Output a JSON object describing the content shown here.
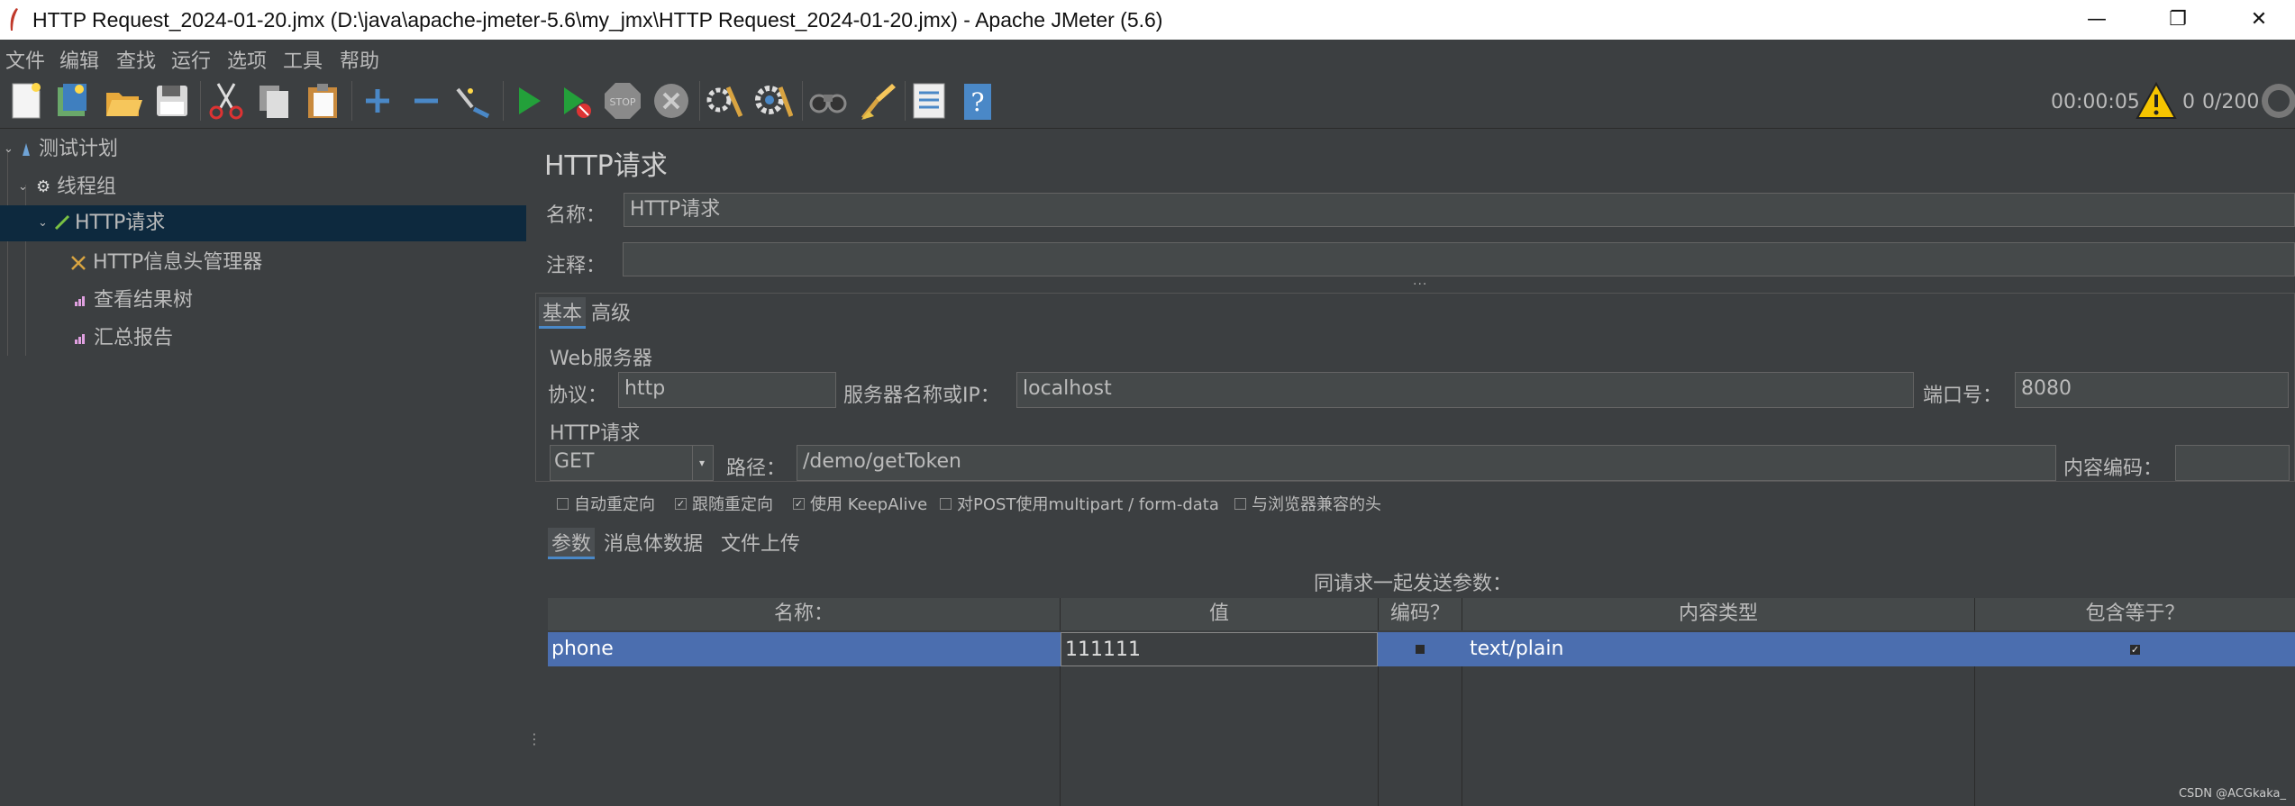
{
  "window": {
    "title": "HTTP Request_2024-01-20.jmx (D:\\java\\apache-jmeter-5.6\\my_jmx\\HTTP Request_2024-01-20.jmx) - Apache JMeter (5.6)",
    "minimize": "—",
    "maximize": "❐",
    "close": "✕"
  },
  "menu": [
    "文件",
    "编辑",
    "查找",
    "运行",
    "选项",
    "工具",
    "帮助"
  ],
  "toolbar": {
    "timer": "00:00:05",
    "warn_count": "0",
    "threads": "0/200",
    "icons": [
      "new-icon",
      "templates-icon",
      "open-icon",
      "save-icon",
      "cut-icon",
      "copy-icon",
      "paste-icon",
      "expand-icon",
      "collapse-icon",
      "toggle-icon",
      "start-icon",
      "start-no-pause-icon",
      "stop-icon",
      "shutdown-icon",
      "clear-icon",
      "clear-all-icon",
      "search-icon",
      "reset-search-icon",
      "function-helper-icon",
      "help-icon"
    ]
  },
  "tree": {
    "items": [
      {
        "label": "测试计划",
        "icon": "test-plan-icon"
      },
      {
        "label": "线程组",
        "icon": "thread-group-icon"
      },
      {
        "label": "HTTP请求",
        "icon": "sampler-icon"
      },
      {
        "label": "HTTP信息头管理器",
        "icon": "header-manager-icon"
      },
      {
        "label": "查看结果树",
        "icon": "listener-icon"
      },
      {
        "label": "汇总报告",
        "icon": "listener-icon"
      }
    ]
  },
  "editor": {
    "heading": "HTTP请求",
    "name_label": "名称：",
    "name_value": "HTTP请求",
    "comment_label": "注释：",
    "comment_value": "",
    "tabs": [
      "基本",
      "高级"
    ],
    "web_server": {
      "title": "Web服务器",
      "protocol_label": "协议：",
      "protocol_value": "http",
      "server_label": "服务器名称或IP：",
      "server_value": "localhost",
      "port_label": "端口号：",
      "port_value": "8080"
    },
    "http_request": {
      "title": "HTTP请求",
      "method": "GET",
      "path_label": "路径：",
      "path_value": "/demo/getToken",
      "encoding_label": "内容编码：",
      "encoding_value": ""
    },
    "options": [
      {
        "label": "自动重定向",
        "checked": false
      },
      {
        "label": "跟随重定向",
        "checked": true
      },
      {
        "label": "使用 KeepAlive",
        "checked": true
      },
      {
        "label": "对POST使用multipart / form-data",
        "checked": false
      },
      {
        "label": "与浏览器兼容的头",
        "checked": false
      }
    ],
    "sub_tabs": [
      "参数",
      "消息体数据",
      "文件上传"
    ],
    "params_caption": "同请求一起发送参数：",
    "params_table": {
      "columns": [
        "名称：",
        "值",
        "编码？",
        "内容类型",
        "包含等于？"
      ],
      "rows": [
        {
          "name": "phone",
          "value": "111111",
          "encode": false,
          "content_type": "text/plain",
          "include_equals": true
        }
      ]
    }
  },
  "watermark": "CSDN @ACGkaka_"
}
